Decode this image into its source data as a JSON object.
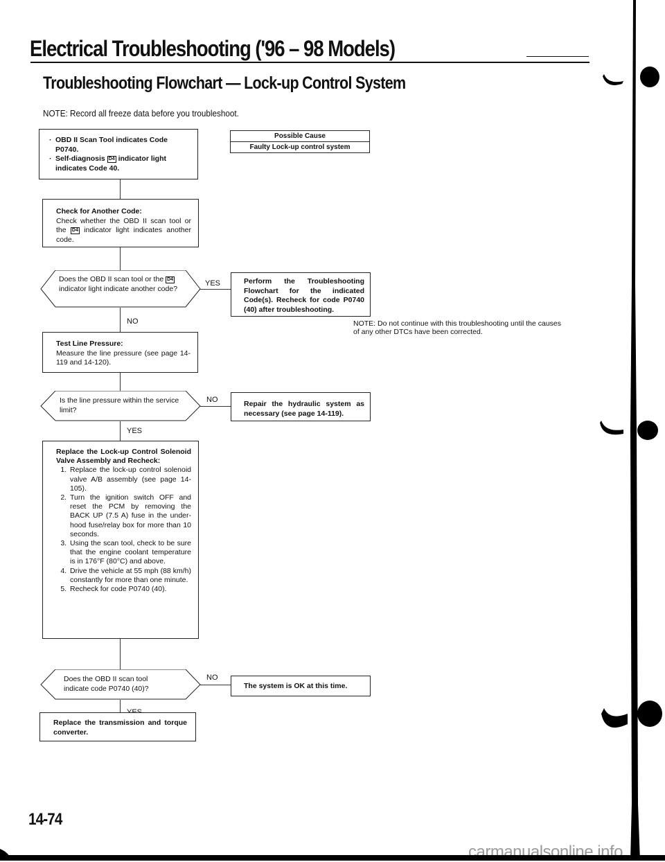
{
  "header": {
    "title": "Electrical Troubleshooting ('96 – 98 Models)",
    "section_title": "Troubleshooting Flowchart — Lock-up Control System",
    "note": "NOTE:  Record all freeze data before you troubleshoot."
  },
  "possible_cause": {
    "header": "Possible Cause",
    "value": "Faulty Lock-up control system"
  },
  "flowchart": {
    "start": {
      "line1_a": "OBD II Scan Tool indicates Code",
      "line1_b": "P0740.",
      "line2_a": "Self-diagnosis",
      "line2_icon": "D4",
      "line2_b": "indicator light",
      "line2_c": "indicates Code 40.",
      "bullet": "·"
    },
    "check_code": {
      "heading": "Check for Another Code:",
      "text_a": "Check whether the OBD II scan tool or the",
      "icon": "D4",
      "text_b": "indicator light indicates another code."
    },
    "decision1": {
      "text_a": "Does the OBD II scan tool or the",
      "icon": "D4",
      "text_b": "indicator light indicate another code?",
      "yes_label": "YES",
      "no_label": "NO"
    },
    "perform": {
      "text": "Perform the Troubleshooting Flowchart for the indicated Code(s). Recheck for code P0740 (40) after troubleshooting."
    },
    "side_note": "NOTE:  Do not continue with this troubleshooting until the causes of any other DTCs have been corrected.",
    "test_pressure": {
      "heading": "Test Line Pressure:",
      "text": "Measure the line pressure (see page 14-119 and 14-120)."
    },
    "decision2": {
      "text": "Is the line pressure within the service limit?",
      "no_label": "NO",
      "yes_label": "YES"
    },
    "repair": {
      "text": "Repair the hydraulic system as necessary (see page 14-119)."
    },
    "replace_solenoid": {
      "heading": "Replace the Lock-up Control Solenoid Valve Assembly and Recheck:",
      "steps": [
        "Replace the lock-up control solenoid valve A/B assembly (see page 14-105).",
        "Turn the ignition switch OFF and reset the PCM by removing the BACK UP (7.5 A) fuse in the under-hood fuse/relay box for more than 10 seconds.",
        "Using the scan tool, check to be sure that the engine coolant temperature is in 176°F (80°C) and above.",
        "Drive the vehicle at 55 mph (88 km/h) constantly for more than one minute.",
        "Recheck for code P0740 (40)."
      ]
    },
    "decision3": {
      "text": "Does the OBD II scan tool indicate code P0740 (40)?",
      "no_label": "NO",
      "yes_label": "YES"
    },
    "system_ok": {
      "text": "The system is OK at this time."
    },
    "replace_transmission": {
      "text": "Replace the transmission and torque converter."
    }
  },
  "footer": {
    "page_number": "14-74",
    "watermark": "carmanualsonline.info"
  }
}
